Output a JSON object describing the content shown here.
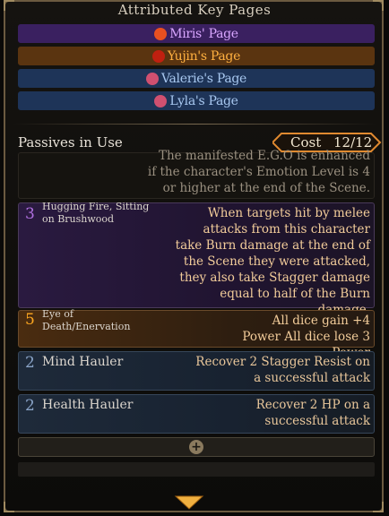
{
  "header": {
    "title": "Attributed Key Pages"
  },
  "key_pages": [
    {
      "label": "Miris' Page",
      "color": "#d9a6ff",
      "bg": "#3a2060",
      "icon_color": "#e85020"
    },
    {
      "label": "Yujin's Page",
      "color": "#ffb040",
      "bg": "#5a3410",
      "icon_color": "#c02010"
    },
    {
      "label": "Valerie's Page",
      "color": "#a8c8f0",
      "bg": "#1e3458",
      "icon_color": "#d05070"
    },
    {
      "label": "Lyla's Page",
      "color": "#a8c8f0",
      "bg": "#1e3458",
      "icon_color": "#d05070"
    }
  ],
  "passives": {
    "title": "Passives in Use",
    "cost_label": "Cost",
    "cost_value": "12/12",
    "partial_desc": [
      "The manifested E.G.O is enhanced",
      "if the character's Emotion Level is 4",
      "or higher at the end of the Scene."
    ],
    "items": [
      {
        "cost": "3",
        "name": "Hugging Fire, Sitting on Brushwood",
        "desc": "When targets hit by melee attacks from this character take Burn damage at the end of the Scene they were attacked, they also take Stagger damage equal to half of the Burn damage.",
        "num_color": "#b070e0",
        "text_color": "#f2cc9a"
      },
      {
        "cost": "5",
        "name": "Eye of Death/Enervation",
        "desc": "All dice gain +4 Power All dice lose 3 Power",
        "num_color": "#ffa820",
        "text_color": "#f2cc9a"
      },
      {
        "cost": "2",
        "name": "Mind Hauler",
        "desc": "Recover 2 Stagger Resist on a successful attack",
        "num_color": "#8aa4c8",
        "text_color": "#e8c69a"
      },
      {
        "cost": "2",
        "name": "Health Hauler",
        "desc": "Recover 2 HP on a successful attack",
        "num_color": "#8aa4c8",
        "text_color": "#e8c69a"
      }
    ]
  },
  "icons": {
    "add": "plus-icon",
    "scroll": "chevron-down-icon",
    "cost_frame": "hexagon-frame"
  }
}
